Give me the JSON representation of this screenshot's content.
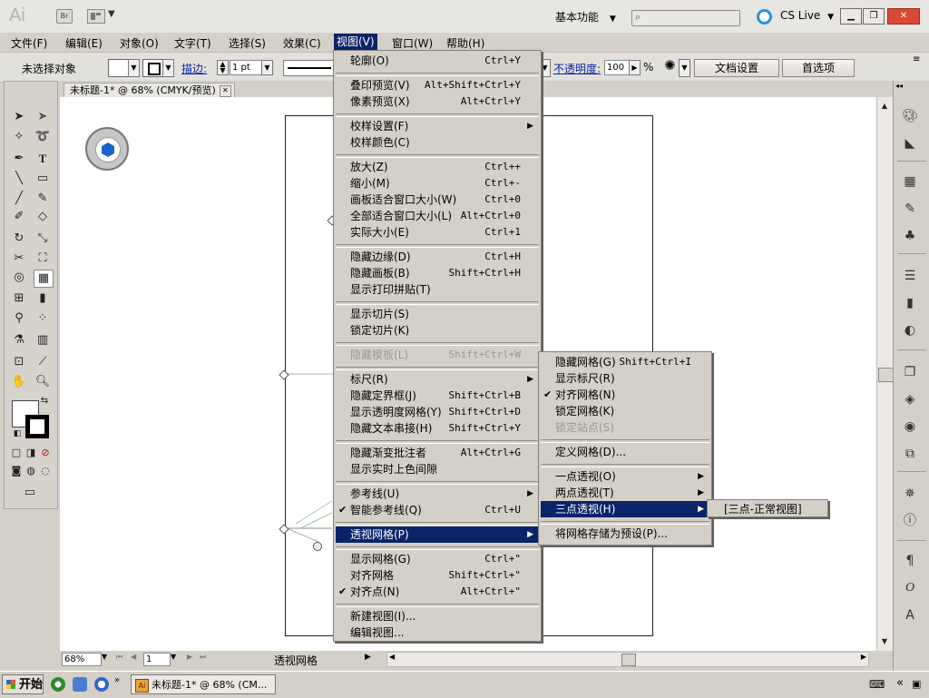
{
  "app_bar": {
    "logo_text": "Ai",
    "bridge_label": "Br",
    "workspace_label": "基本功能",
    "cs_live_label": "CS Live",
    "search_placeholder": ""
  },
  "menubar": [
    "文件(F)",
    "编辑(E)",
    "对象(O)",
    "文字(T)",
    "选择(S)",
    "效果(C)",
    "视图(V)",
    "窗口(W)",
    "帮助(H)"
  ],
  "control_bar": {
    "selection_status": "未选择对象",
    "stroke_label": "描边:",
    "stroke_weight": "1 pt",
    "opacity_label": "不透明度:",
    "opacity_value": "100",
    "opacity_unit": "%",
    "doc_settings_button": "文档设置",
    "preferences_button": "首选项"
  },
  "document": {
    "tab_title": "未标题-1* @ 68% (CMYK/预览)"
  },
  "view_menu": {
    "items": [
      {
        "label": "轮廓(O)",
        "shortcut": "Ctrl+Y"
      },
      {
        "sep": true
      },
      {
        "label": "叠印预览(V)",
        "shortcut": "Alt+Shift+Ctrl+Y"
      },
      {
        "label": "像素预览(X)",
        "shortcut": "Alt+Ctrl+Y"
      },
      {
        "sep": true
      },
      {
        "label": "校样设置(F)",
        "submenu": true
      },
      {
        "label": "校样颜色(C)"
      },
      {
        "sep": true
      },
      {
        "label": "放大(Z)",
        "shortcut": "Ctrl++"
      },
      {
        "label": "缩小(M)",
        "shortcut": "Ctrl+-"
      },
      {
        "label": "画板适合窗口大小(W)",
        "shortcut": "Ctrl+0"
      },
      {
        "label": "全部适合窗口大小(L)",
        "shortcut": "Alt+Ctrl+0"
      },
      {
        "label": "实际大小(E)",
        "shortcut": "Ctrl+1"
      },
      {
        "sep": true
      },
      {
        "label": "隐藏边缘(D)",
        "shortcut": "Ctrl+H"
      },
      {
        "label": "隐藏画板(B)",
        "shortcut": "Shift+Ctrl+H"
      },
      {
        "label": "显示打印拼贴(T)"
      },
      {
        "sep": true
      },
      {
        "label": "显示切片(S)"
      },
      {
        "label": "锁定切片(K)"
      },
      {
        "sep": true
      },
      {
        "label": "隐藏模板(L)",
        "shortcut": "Shift+Ctrl+W",
        "disabled": true
      },
      {
        "sep": true
      },
      {
        "label": "标尺(R)",
        "submenu": true
      },
      {
        "label": "隐藏定界框(J)",
        "shortcut": "Shift+Ctrl+B"
      },
      {
        "label": "显示透明度网格(Y)",
        "shortcut": "Shift+Ctrl+D"
      },
      {
        "label": "隐藏文本串接(H)",
        "shortcut": "Shift+Ctrl+Y"
      },
      {
        "sep": true
      },
      {
        "label": "隐藏渐变批注者",
        "shortcut": "Alt+Ctrl+G"
      },
      {
        "label": "显示实时上色间隙"
      },
      {
        "sep": true
      },
      {
        "label": "参考线(U)",
        "submenu": true
      },
      {
        "label": "智能参考线(Q)",
        "shortcut": "Ctrl+U",
        "checked": true
      },
      {
        "sep": true
      },
      {
        "label": "透视网格(P)",
        "submenu": true,
        "highlighted": true
      },
      {
        "sep": true
      },
      {
        "label": "显示网格(G)",
        "shortcut": "Ctrl+\""
      },
      {
        "label": "对齐网格",
        "shortcut": "Shift+Ctrl+\""
      },
      {
        "label": "对齐点(N)",
        "shortcut": "Alt+Ctrl+\"",
        "checked": true
      },
      {
        "sep": true
      },
      {
        "label": "新建视图(I)..."
      },
      {
        "label": "编辑视图..."
      }
    ]
  },
  "perspective_submenu": {
    "items": [
      {
        "label": "隐藏网格(G)",
        "shortcut": "Shift+Ctrl+I"
      },
      {
        "label": "显示标尺(R)"
      },
      {
        "label": "对齐网格(N)",
        "checked": true
      },
      {
        "label": "锁定网格(K)"
      },
      {
        "label": "锁定站点(S)",
        "disabled": true
      },
      {
        "sep": true
      },
      {
        "label": "定义网格(D)..."
      },
      {
        "sep": true
      },
      {
        "label": "一点透视(O)",
        "submenu": true
      },
      {
        "label": "两点透视(T)",
        "submenu": true
      },
      {
        "label": "三点透视(H)",
        "submenu": true,
        "highlighted": true
      },
      {
        "sep": true
      },
      {
        "label": "将网格存储为预设(P)..."
      }
    ]
  },
  "three_point_submenu": {
    "label": "[三点-正常视图]"
  },
  "status_bar": {
    "zoom": "68%",
    "page": "1",
    "status_text": "透视网格"
  },
  "taskbar": {
    "start_label": "开始",
    "app_label": "未标题-1* @ 68% (CM...",
    "app_icon_text": "Ai"
  },
  "colors": {
    "menu_highlight": "#0a246a",
    "menu_bg": "#d4d0c8",
    "link": "#0b27a0"
  }
}
